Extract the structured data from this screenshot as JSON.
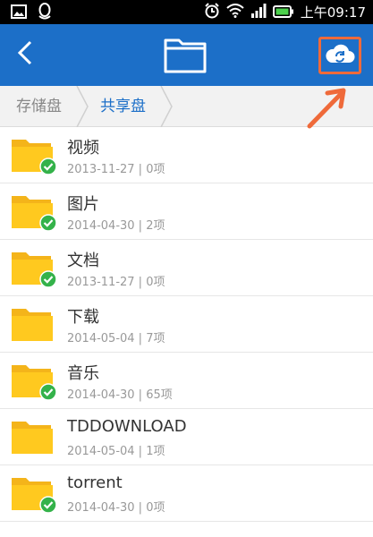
{
  "status_bar": {
    "time": "上午09:17",
    "icons": [
      "image-icon",
      "qq-icon",
      "alarm-icon",
      "wifi-icon",
      "signal-icon",
      "battery-icon"
    ]
  },
  "toolbar": {
    "back_icon": "chevron-left-icon",
    "title_icon": "folder-icon",
    "cloud_icon": "cloud-sync-icon",
    "highlight_color": "#ef6a3a",
    "bar_color": "#1c6fc8"
  },
  "breadcrumb": {
    "items": [
      {
        "label": "存储盘"
      },
      {
        "label": "共享盘"
      }
    ]
  },
  "files": [
    {
      "name": "视频",
      "meta": "2013-11-27 | 0项",
      "synced": true
    },
    {
      "name": "图片",
      "meta": "2014-04-30 | 2项",
      "synced": true
    },
    {
      "name": "文档",
      "meta": "2013-11-27 | 0项",
      "synced": true
    },
    {
      "name": "下载",
      "meta": "2014-05-04 | 7项",
      "synced": false
    },
    {
      "name": "音乐",
      "meta": "2014-04-30 | 65项",
      "synced": true
    },
    {
      "name": "TDDOWNLOAD",
      "meta": "2014-05-04 | 1项",
      "synced": false
    },
    {
      "name": "torrent",
      "meta": "2014-04-30 | 0项",
      "synced": true
    }
  ]
}
